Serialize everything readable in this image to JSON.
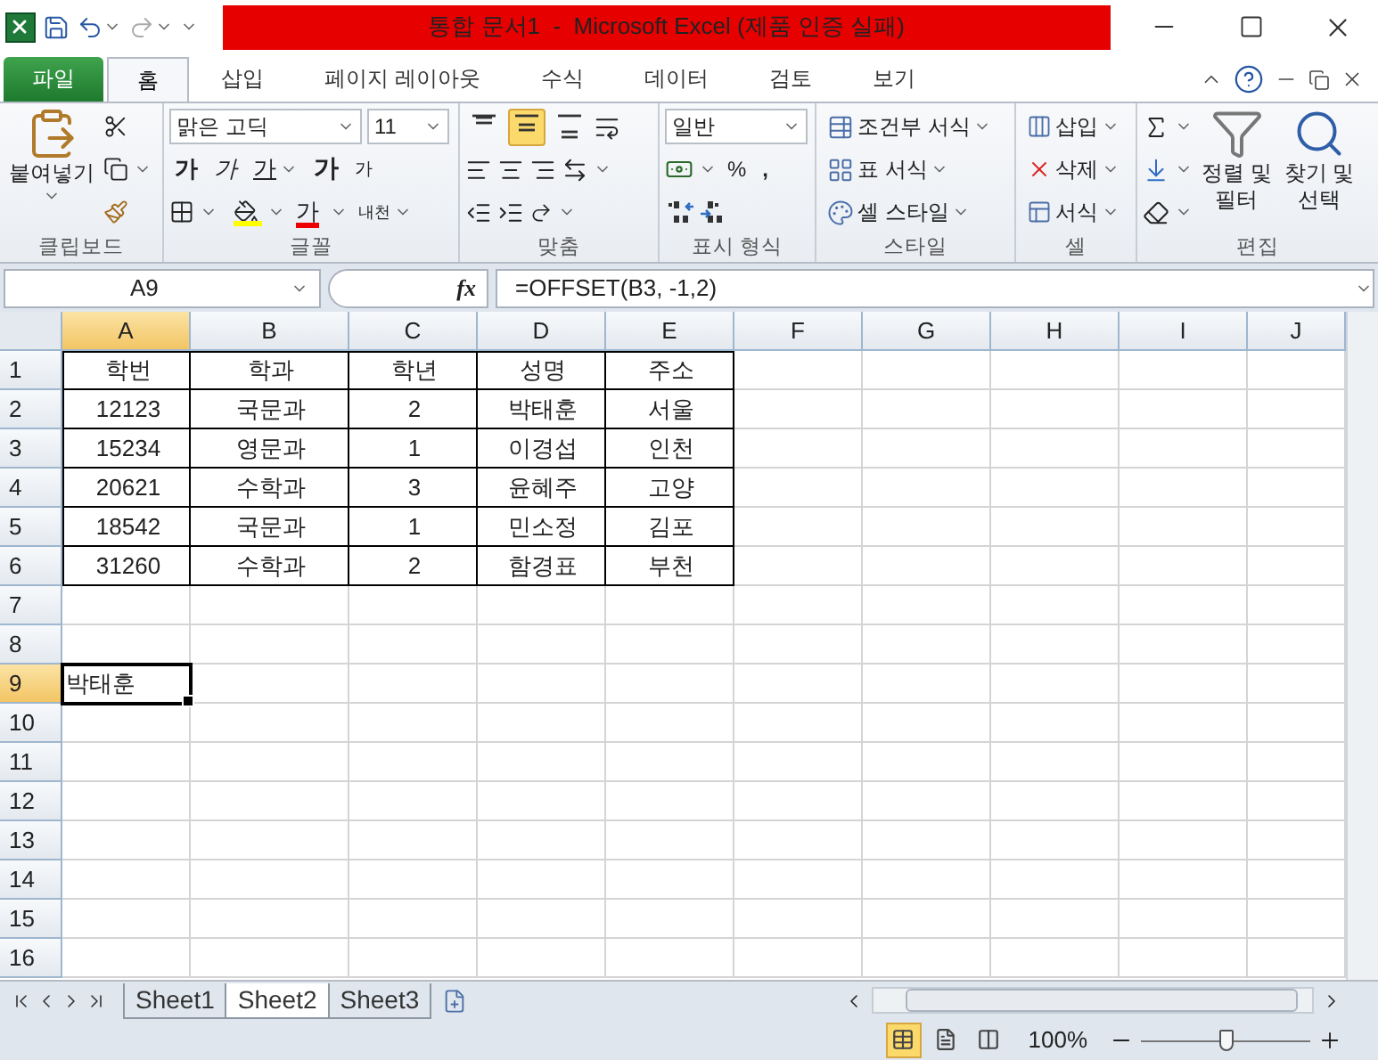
{
  "title_bar": {
    "title": "통합 문서1  -  Microsoft Excel (제품 인증 실패)"
  },
  "ribbon_tabs": [
    {
      "label": "파일",
      "kind": "file",
      "selected": false
    },
    {
      "label": "홈",
      "kind": "tab",
      "selected": true
    },
    {
      "label": "삽입",
      "kind": "tab",
      "selected": false
    },
    {
      "label": "페이지 레이아웃",
      "kind": "tab",
      "selected": false
    },
    {
      "label": "수식",
      "kind": "tab",
      "selected": false
    },
    {
      "label": "데이터",
      "kind": "tab",
      "selected": false
    },
    {
      "label": "검토",
      "kind": "tab",
      "selected": false
    },
    {
      "label": "보기",
      "kind": "tab",
      "selected": false
    }
  ],
  "clipboard": {
    "paste": "붙여넣기",
    "label": "클립보드"
  },
  "font": {
    "name": "맑은 고딕",
    "size": "11",
    "bold": "가",
    "italic": "가",
    "underline": "가",
    "font_color": "가",
    "grow": "가",
    "shrink": "가",
    "phonetic": "내천",
    "label": "글꼴"
  },
  "alignment": {
    "vertical": [
      {
        "selected": false
      },
      {
        "selected": true
      },
      {
        "selected": false
      }
    ],
    "label": "맞춤"
  },
  "number": {
    "format": "일반",
    "percent": "%",
    "comma": ",",
    "label": "표시 형식"
  },
  "styles": {
    "items": [
      "조건부 서식",
      "표 서식",
      "셀 스타일"
    ],
    "label": "스타일"
  },
  "cells": {
    "items": [
      "삽입",
      "삭제",
      "서식"
    ],
    "label": "셀"
  },
  "editing": {
    "sort": [
      "정렬 및",
      "필터"
    ],
    "find": [
      "찾기 및",
      "선택"
    ],
    "label": "편집"
  },
  "formula_bar": {
    "name_box": "A9",
    "fx": "fx",
    "formula": "=OFFSET(B3, -1,2)"
  },
  "grid": {
    "columns": [
      {
        "label": "A",
        "selected": true
      },
      {
        "label": "B",
        "selected": false
      },
      {
        "label": "C",
        "selected": false
      },
      {
        "label": "D",
        "selected": false
      },
      {
        "label": "E",
        "selected": false
      },
      {
        "label": "F",
        "selected": false
      },
      {
        "label": "G",
        "selected": false
      },
      {
        "label": "H",
        "selected": false
      },
      {
        "label": "I",
        "selected": false
      },
      {
        "label": "J",
        "selected": false
      }
    ],
    "rows": [
      {
        "label": "1",
        "kind": "table",
        "selected": false,
        "cells": [
          {
            "text": "학번",
            "selected": false
          },
          {
            "text": "학과",
            "selected": false
          },
          {
            "text": "학년",
            "selected": false
          },
          {
            "text": "성명",
            "selected": false
          },
          {
            "text": "주소",
            "selected": false
          }
        ]
      },
      {
        "label": "2",
        "kind": "table",
        "selected": false,
        "cells": [
          {
            "text": "12123",
            "selected": false
          },
          {
            "text": "국문과",
            "selected": false
          },
          {
            "text": "2",
            "selected": false
          },
          {
            "text": "박태훈",
            "selected": false
          },
          {
            "text": "서울",
            "selected": false
          }
        ]
      },
      {
        "label": "3",
        "kind": "table",
        "selected": false,
        "cells": [
          {
            "text": "15234",
            "selected": false
          },
          {
            "text": "영문과",
            "selected": false
          },
          {
            "text": "1",
            "selected": false
          },
          {
            "text": "이경섭",
            "selected": false
          },
          {
            "text": "인천",
            "selected": false
          }
        ]
      },
      {
        "label": "4",
        "kind": "table",
        "selected": false,
        "cells": [
          {
            "text": "20621",
            "selected": false
          },
          {
            "text": "수학과",
            "selected": false
          },
          {
            "text": "3",
            "selected": false
          },
          {
            "text": "윤혜주",
            "selected": false
          },
          {
            "text": "고양",
            "selected": false
          }
        ]
      },
      {
        "label": "5",
        "kind": "table",
        "selected": false,
        "cells": [
          {
            "text": "18542",
            "selected": false
          },
          {
            "text": "국문과",
            "selected": false
          },
          {
            "text": "1",
            "selected": false
          },
          {
            "text": "민소정",
            "selected": false
          },
          {
            "text": "김포",
            "selected": false
          }
        ]
      },
      {
        "label": "6",
        "kind": "table",
        "selected": false,
        "cells": [
          {
            "text": "31260",
            "selected": false
          },
          {
            "text": "수학과",
            "selected": false
          },
          {
            "text": "2",
            "selected": false
          },
          {
            "text": "함경표",
            "selected": false
          },
          {
            "text": "부천",
            "selected": false
          }
        ]
      },
      {
        "label": "7",
        "kind": "plain",
        "selected": false
      },
      {
        "label": "8",
        "kind": "plain",
        "selected": false
      },
      {
        "label": "9",
        "kind": "plain",
        "selected": true,
        "cells": [
          {
            "text": "박태훈",
            "selected": true
          }
        ]
      },
      {
        "label": "10",
        "kind": "plain",
        "selected": false
      },
      {
        "label": "11",
        "kind": "plain",
        "selected": false
      },
      {
        "label": "12",
        "kind": "plain",
        "selected": false
      },
      {
        "label": "13",
        "kind": "plain",
        "selected": false
      },
      {
        "label": "14",
        "kind": "plain",
        "selected": false
      },
      {
        "label": "15",
        "kind": "plain",
        "selected": false
      },
      {
        "label": "16",
        "kind": "plain",
        "selected": false
      }
    ]
  },
  "sheet_tabs": [
    {
      "label": "Sheet1",
      "selected": false
    },
    {
      "label": "Sheet2",
      "selected": true
    },
    {
      "label": "Sheet3",
      "selected": false
    }
  ],
  "status_bar": {
    "views": [
      {
        "selected": true
      },
      {
        "selected": false
      },
      {
        "selected": false
      }
    ],
    "zoom": "100%",
    "zoom_slider": {
      "level": 0.5
    }
  }
}
